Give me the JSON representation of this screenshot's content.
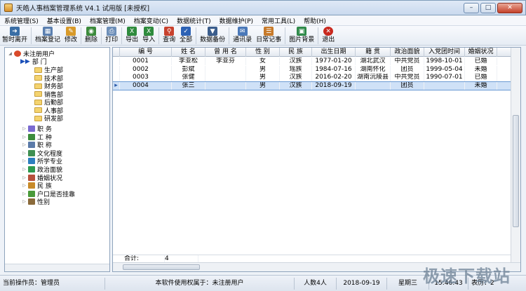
{
  "window": {
    "title": "天皓人事档案管理系统  V4.1 试用版      [未授权]"
  },
  "menu": [
    {
      "label": "系统管理(S)"
    },
    {
      "label": "基本设置(B)"
    },
    {
      "label": "档案管理(M)"
    },
    {
      "label": "档案变动(C)"
    },
    {
      "label": "数据统计(T)"
    },
    {
      "label": "数据维护(P)"
    },
    {
      "label": "常用工具(L)"
    },
    {
      "label": "帮助(H)"
    }
  ],
  "toolbar": [
    {
      "label": "暂时离开",
      "color": "#3a6ea5"
    },
    {
      "label": "档案登记",
      "color": "#5a7fb0"
    },
    {
      "label": "修改",
      "color": "#d89a2a"
    },
    {
      "label": "删除",
      "color": "#3b8a3b"
    },
    {
      "label": "打印",
      "color": "#6c8eb8"
    },
    {
      "label": "导出",
      "color": "#2e8b3d"
    },
    {
      "label": "导入",
      "color": "#2e8b3d"
    },
    {
      "label": "查询",
      "color": "#c8422e"
    },
    {
      "label": "全部",
      "color": "#2d62b5"
    },
    {
      "label": "数据备份",
      "color": "#3b5d8c"
    },
    {
      "label": "通讯录",
      "color": "#4a78b8"
    },
    {
      "label": "日常记事",
      "color": "#c77a2a"
    },
    {
      "label": "图片背景",
      "color": "#2f8a4a"
    },
    {
      "label": "退出",
      "color": "#c8281e"
    }
  ],
  "tree": {
    "root": "未注册用户",
    "dept": "部    门",
    "departments": [
      "生产部",
      "技术部",
      "财务部",
      "销售部",
      "后勤部",
      "人事部",
      "研发部"
    ],
    "categories": [
      {
        "label": "职    务",
        "color": "#7a6ad0"
      },
      {
        "label": "工    种",
        "color": "#3c8c3c"
      },
      {
        "label": "职    称",
        "color": "#5b7aa8"
      },
      {
        "label": "文化程度",
        "color": "#3f8f52"
      },
      {
        "label": "所学专业",
        "color": "#2e7fbf"
      },
      {
        "label": "政治面貌",
        "color": "#2e9a4e"
      },
      {
        "label": "婚姻状况",
        "color": "#b8503c"
      },
      {
        "label": "民    族",
        "color": "#c88a2a"
      },
      {
        "label": "户口是否挂靠",
        "color": "#4a9a3a"
      },
      {
        "label": "性别",
        "color": "#8a6a3a"
      }
    ]
  },
  "table": {
    "columns": [
      "编    号",
      "姓    名",
      "曾 用 名",
      "性    别",
      "民    族",
      "出生日期",
      "籍    贯",
      "政治面貌",
      "入党团时间",
      "婚姻状况"
    ],
    "rows": [
      [
        "0001",
        "李亚松",
        "李亚芬",
        "女",
        "汉族",
        "1977-01-20",
        "湖北武汉",
        "中共党员",
        "1998-10-01",
        "已婚"
      ],
      [
        "0002",
        "彭斌",
        "",
        "男",
        "瑶族",
        "1984-07-16",
        "湖南怀化",
        "团员",
        "1999-05-04",
        "未婚"
      ],
      [
        "0003",
        "张健",
        "",
        "男",
        "汉族",
        "2016-02-20",
        "湖南沅陵县",
        "中共党员",
        "1990-07-01",
        "已婚"
      ],
      [
        "0004",
        "张三",
        "",
        "男",
        "汉族",
        "2018-09-19",
        "",
        "团员",
        "",
        "未婚"
      ]
    ],
    "selected_row": 3,
    "total_label": "合计:",
    "total_value": "4"
  },
  "status": {
    "operator": "当前操作员：管理员",
    "owner": "本软件使用权属于：未注册用户",
    "count": "人数4人",
    "date": "2018-09-19",
    "weekday": "星期三",
    "time": "15:46:43",
    "page": "表历：2"
  },
  "watermark": "极速下载站"
}
